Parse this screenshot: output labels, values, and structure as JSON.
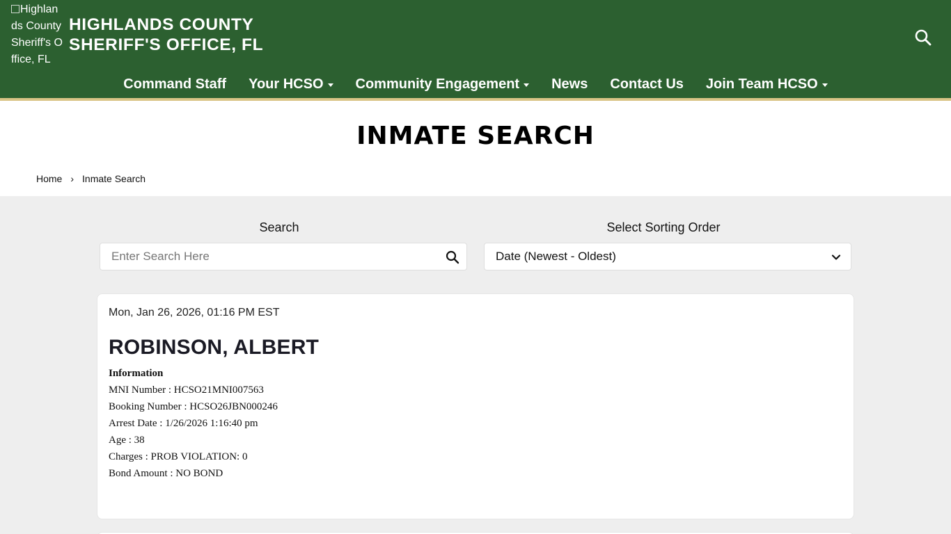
{
  "header": {
    "logo_alt": "Highlands County Sheriff's Office, FL",
    "title_line1": "HIGHLANDS COUNTY",
    "title_line2": "SHERIFF'S OFFICE, FL",
    "search_icon": "search-icon",
    "brand_color": "#2c6030",
    "accent_color": "#d9c486"
  },
  "nav": {
    "items": [
      {
        "label": "Command Staff",
        "dropdown": false
      },
      {
        "label": "Your HCSO",
        "dropdown": true
      },
      {
        "label": "Community Engagement",
        "dropdown": true
      },
      {
        "label": "News",
        "dropdown": false
      },
      {
        "label": "Contact Us",
        "dropdown": false
      },
      {
        "label": "Join Team HCSO",
        "dropdown": true
      }
    ]
  },
  "page": {
    "title": "INMATE SEARCH",
    "breadcrumb": {
      "home": "Home",
      "separator": "›",
      "current": "Inmate Search"
    }
  },
  "search": {
    "label": "Search",
    "placeholder": "Enter Search Here",
    "value": "",
    "icon": "search-icon"
  },
  "sort": {
    "label": "Select Sorting Order",
    "selected": "Date (Newest - Oldest)",
    "icon": "chevron-down-icon"
  },
  "results": [
    {
      "timestamp": "Mon, Jan 26, 2026, 01:16 PM EST",
      "name": "ROBINSON, ALBERT",
      "info_heading": "Information",
      "fields": [
        "MNI Number : HCSO21MNI007563",
        "Booking Number : HCSO26JBN000246",
        "Arrest Date : 1/26/2026 1:16:40 pm",
        "Age : 38",
        "Charges : PROB VIOLATION: 0",
        "Bond Amount : NO BOND"
      ]
    }
  ]
}
